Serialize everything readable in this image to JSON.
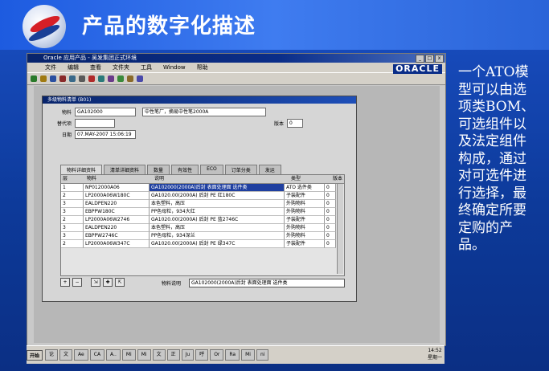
{
  "slide": {
    "title": "产品的数字化描述",
    "side_text": "一个ATO模型可以由选项类BOM、可选组件以及法定组件构成，通过对可选件进行选择，最终确定所要定购的产品。"
  },
  "app": {
    "title": "Oracle 应用产品 - 吴发集团正式环境",
    "menu": [
      "文件",
      "编辑",
      "查看",
      "文件夹",
      "工具",
      "Window",
      "帮助"
    ],
    "brand": "ORACLE"
  },
  "bom_form": {
    "title": "多级物料清单 (B01)",
    "item_label": "物料",
    "item_value": "GA102000",
    "item_desc": "中性笔厂，摘易中性笔2000A",
    "alt_label": "替代项",
    "alt_value": "",
    "date_label": "日期",
    "date_value": "07.MAY-2007 15:06:19",
    "rev_label": "版本",
    "rev_value": "0",
    "tabs": [
      "物料详细资料",
      "清单详细资料",
      "数量",
      "有效性",
      "ECO",
      "订单分类",
      "发运"
    ],
    "columns": [
      "层",
      "物料",
      "说明",
      "类型",
      "版本"
    ],
    "rows": [
      {
        "level": "1",
        "item": "NP012000A06",
        "desc": "GA102000(2000A)后封 表面处理面 选件类",
        "type": "ATO 选件类",
        "rev": "0"
      },
      {
        "level": "2",
        "item": "LP2000A06W180C",
        "desc": "GA1020.00(2000A) 后封 PE 红180C",
        "type": "子装配件",
        "rev": "0"
      },
      {
        "level": "3",
        "item": "EALDPEN220",
        "desc": "本色塑料，高压",
        "type": "外购物料",
        "rev": "0"
      },
      {
        "level": "3",
        "item": "EBPPW180C",
        "desc": "PP色母粒，934大红",
        "type": "外购物料",
        "rev": "0"
      },
      {
        "level": "2",
        "item": "LP2000A06W2746",
        "desc": "GA1020.00(2000A) 后封 PE 蓝2746C",
        "type": "子装配件",
        "rev": "0"
      },
      {
        "level": "3",
        "item": "EALDPEN220",
        "desc": "本色塑料，高压",
        "type": "外购物料",
        "rev": "0"
      },
      {
        "level": "3",
        "item": "EBPPW2746C",
        "desc": "PP色母粒，934深兰",
        "type": "外购物料",
        "rev": "0"
      },
      {
        "level": "2",
        "item": "LP2000A06W347C",
        "desc": "GA1020.00(2000A) 后封 PE 绿347C",
        "type": "子装配件",
        "rev": "0"
      }
    ],
    "desc_label": "物料说明",
    "desc_value": "GA102000(2000A)后封 表面处理面 选件类"
  },
  "taskbar": {
    "start": "开始",
    "items": [
      "论",
      "文",
      "Ae",
      "CA",
      "A..",
      "Mi",
      "Mi",
      "文",
      "正",
      "Ju",
      "呼",
      "Or",
      "Ra",
      "Mi",
      "ni"
    ],
    "time": "14:52",
    "day": "星期一"
  }
}
